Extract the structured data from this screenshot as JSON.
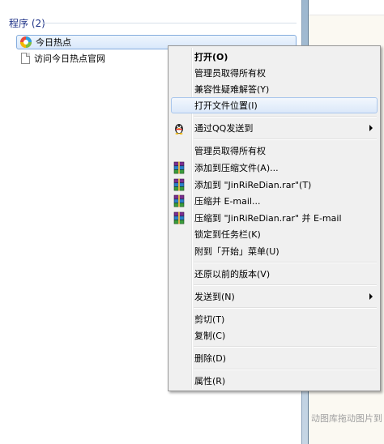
{
  "background": {
    "partial_text": "动图库拖动图片到"
  },
  "start_menu": {
    "section_title": "程序 (2)",
    "programs": [
      {
        "label": "今日热点",
        "icon": "colorful-app-icon",
        "selected": true
      },
      {
        "label": "访问今日热点官网",
        "icon": "document-icon",
        "selected": false
      }
    ]
  },
  "context_menu": {
    "items": {
      "open": "打开(O)",
      "admin_ownership_1": "管理员取得所有权",
      "compat_troubleshoot": "兼容性疑难解答(Y)",
      "open_file_location": "打开文件位置(I)",
      "send_via_qq": "通过QQ发送到",
      "admin_ownership_2": "管理员取得所有权",
      "add_to_archive": "添加到压缩文件(A)...",
      "add_to_rar": "添加到 \"JinRiReDian.rar\"(T)",
      "compress_email": "压缩并 E-mail...",
      "compress_to_rar_email": "压缩到 \"JinRiReDian.rar\" 并 E-mail",
      "pin_taskbar": "锁定到任务栏(K)",
      "pin_start": "附到「开始」菜单(U)",
      "restore_previous": "还原以前的版本(V)",
      "send_to": "发送到(N)",
      "cut": "剪切(T)",
      "copy": "复制(C)",
      "delete": "删除(D)",
      "properties": "属性(R)"
    },
    "hovered_item": "open_file_location",
    "icons": {
      "qq": "qq-penguin-icon",
      "winrar": "winrar-books-icon"
    }
  }
}
